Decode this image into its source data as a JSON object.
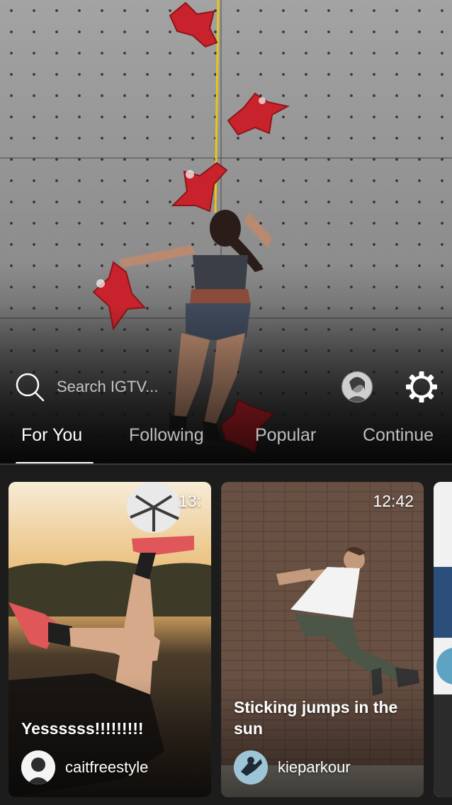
{
  "search": {
    "placeholder": "Search IGTV..."
  },
  "tabs": [
    {
      "label": "For You",
      "active": true
    },
    {
      "label": "Following",
      "active": false
    },
    {
      "label": "Popular",
      "active": false
    },
    {
      "label": "Continue",
      "active": false
    }
  ],
  "videos": [
    {
      "title": "Yessssss!!!!!!!!!",
      "username": "caitfreestyle",
      "duration": "13:"
    },
    {
      "title": "Sticking jumps in the sun",
      "username": "kieparkour",
      "duration": "12:42"
    },
    {
      "title": "",
      "username": "",
      "duration": ""
    }
  ],
  "icons": {
    "search": "search-icon",
    "settings": "gear-icon",
    "profile": "profile-avatar"
  },
  "colors": {
    "hold_red": "#c8232c",
    "background": "#000000",
    "active_tab": "#ffffff",
    "inactive_tab": "#b8b8b8"
  }
}
